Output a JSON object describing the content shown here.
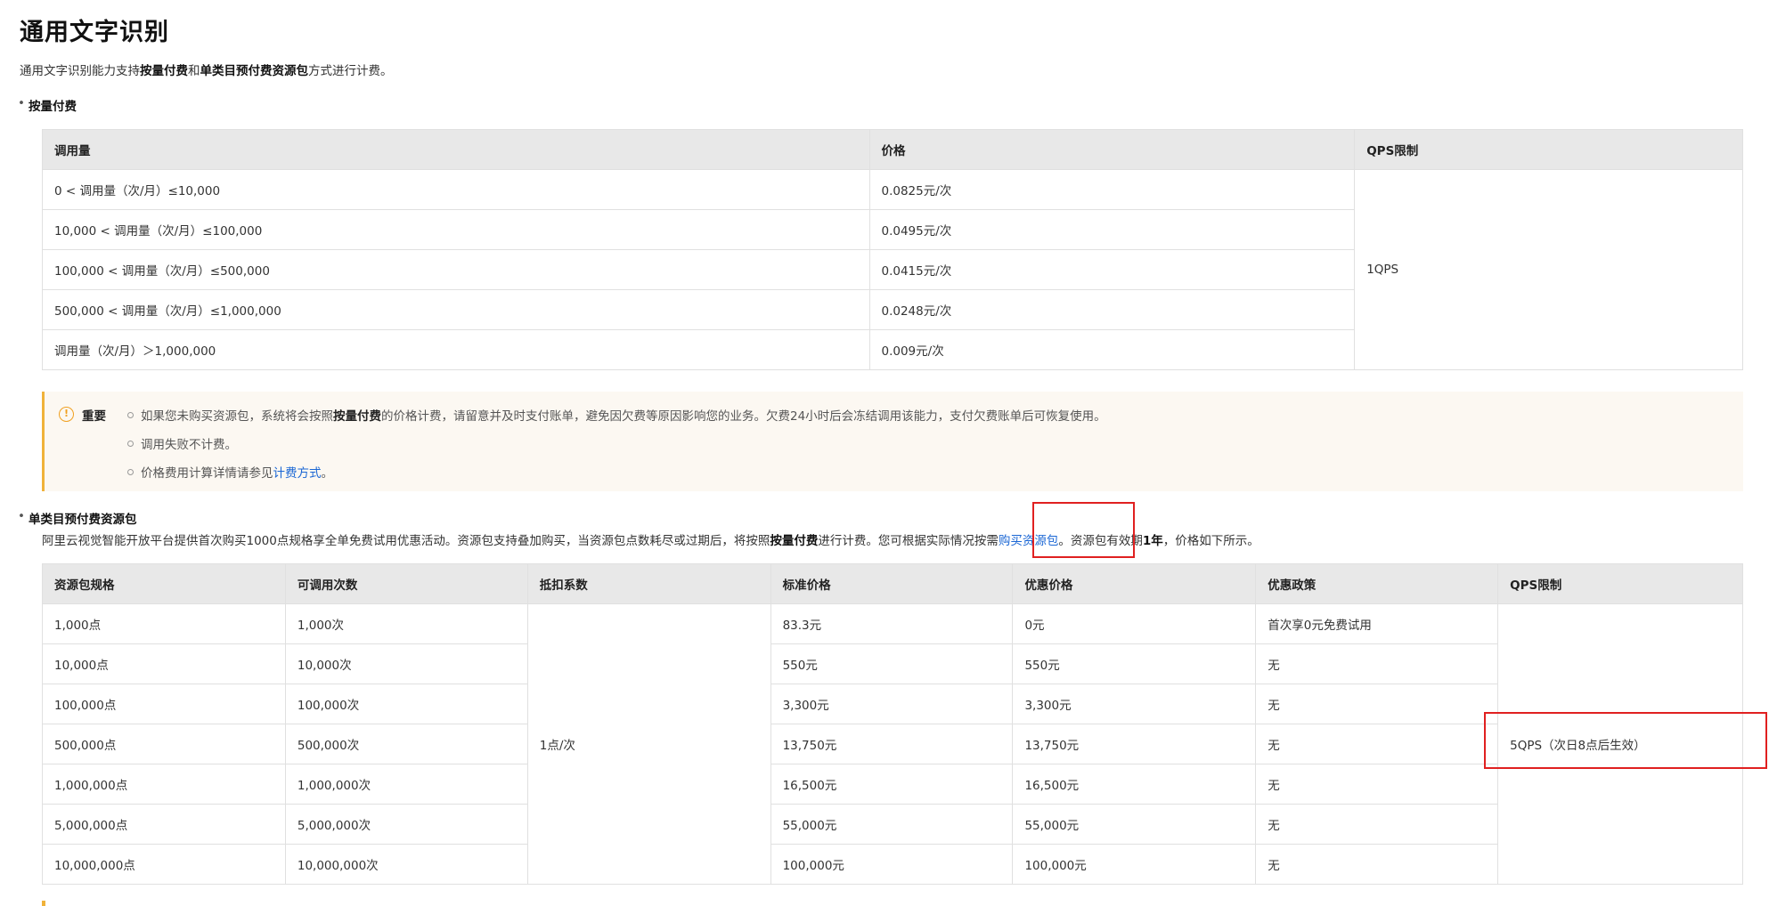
{
  "title": "通用文字识别",
  "intro": {
    "prefix": "通用文字识别能力支持",
    "bold1": "按量付费",
    "mid": "和",
    "bold2": "单类目预付费资源包",
    "suffix": "方式进行计费。"
  },
  "payg": {
    "heading": "按量付费",
    "columns": [
      "调用量",
      "价格",
      "QPS限制"
    ],
    "rows": [
      {
        "volume": "0 < 调用量（次/月）≤10,000",
        "price": "0.0825元/次"
      },
      {
        "volume": "10,000 < 调用量（次/月）≤100,000",
        "price": "0.0495元/次"
      },
      {
        "volume": "100,000 < 调用量（次/月）≤500,000",
        "price": "0.0415元/次"
      },
      {
        "volume": "500,000 < 调用量（次/月）≤1,000,000",
        "price": "0.0248元/次"
      },
      {
        "volume": "调用量（次/月）＞1,000,000",
        "price": "0.009元/次"
      }
    ],
    "qps": "1QPS"
  },
  "notice": {
    "label": "重要",
    "item1_prefix": "如果您未购买资源包，系统将会按照",
    "item1_bold": "按量付费",
    "item1_suffix": "的价格计费，请留意并及时支付账单，避免因欠费等原因影响您的业务。欠费24小时后会冻结调用该能力，支付欠费账单后可恢复使用。",
    "item2": "调用失败不计费。",
    "item3_prefix": "价格费用计算详情请参见",
    "item3_link": "计费方式",
    "item3_suffix": "。"
  },
  "pack": {
    "heading": "单类目预付费资源包",
    "desc_part1": "阿里云视觉智能开放平台提供首次购买1000点规格享全单免费试用优惠活动。资源包支持叠加购买，当资源包点数耗尽或过期后，将按照",
    "desc_bold1": "按量付费",
    "desc_part2": "进行计费。您可根据实际情况按需",
    "desc_link": "购买资源包",
    "desc_part3": "。资源包有效期",
    "desc_bold2": "1年",
    "desc_part4": "，价格如下所示。",
    "columns": [
      "资源包规格",
      "可调用次数",
      "抵扣系数",
      "标准价格",
      "优惠价格",
      "优惠政策",
      "QPS限制"
    ],
    "rows": [
      {
        "spec": "1,000点",
        "calls": "1,000次",
        "std": "83.3元",
        "promo": "0元",
        "policy": "首次享0元免费试用"
      },
      {
        "spec": "10,000点",
        "calls": "10,000次",
        "std": "550元",
        "promo": "550元",
        "policy": "无"
      },
      {
        "spec": "100,000点",
        "calls": "100,000次",
        "std": "3,300元",
        "promo": "3,300元",
        "policy": "无"
      },
      {
        "spec": "500,000点",
        "calls": "500,000次",
        "std": "13,750元",
        "promo": "13,750元",
        "policy": "无"
      },
      {
        "spec": "1,000,000点",
        "calls": "1,000,000次",
        "std": "16,500元",
        "promo": "16,500元",
        "policy": "无"
      },
      {
        "spec": "5,000,000点",
        "calls": "5,000,000次",
        "std": "55,000元",
        "promo": "55,000元",
        "policy": "无"
      },
      {
        "spec": "10,000,000点",
        "calls": "10,000,000次",
        "std": "100,000元",
        "promo": "100,000元",
        "policy": "无"
      }
    ],
    "deduction": "1点/次",
    "qps": "5QPS（次日8点后生效）"
  },
  "colors": {
    "link": "#1a66d4",
    "highlight_box": "#e02020",
    "notice_accent": "#f0b23a"
  }
}
